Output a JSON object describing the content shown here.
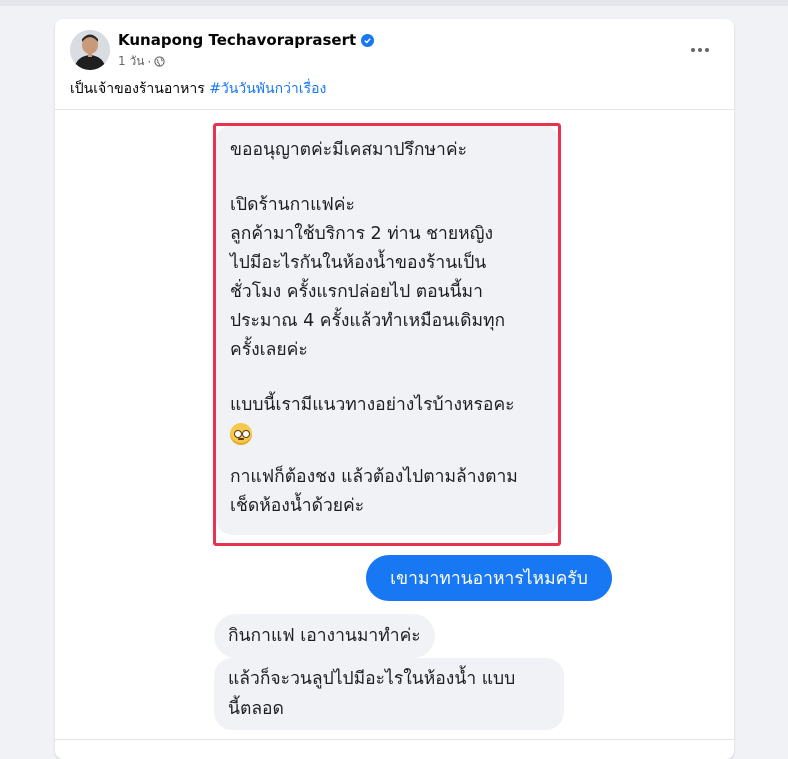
{
  "post": {
    "author": "Kunapong Techavoraprasert",
    "time": "1 วัน",
    "separator": "·",
    "caption_text": "เป็นเจ้าของร้านอาหาร",
    "hashtag": "#วันวันพันกว่าเรื่อง"
  },
  "icons": {
    "verified": "verified-badge-icon",
    "privacy": "globe-icon",
    "more": "more-options-icon",
    "emoji": "pleading-face-emoji"
  },
  "chat": {
    "highlighted_message": {
      "p1": "ขออนุญาตค่ะมีเคสมาปรึกษาค่ะ",
      "p2": "เปิดร้านกาแฟค่ะ\nลูกค้ามาใช้บริการ 2 ท่าน ชายหญิง\nไปมีอะไรกันในห้องน้ำของร้านเป็น\nชั่วโมง ครั้งแรกปล่อยไป ตอนนี้มา\nประมาณ 4 ครั้งแล้วทำเหมือนเดิมทุก\nครั้งเลยค่ะ",
      "p3": "แบบนี้เรามีแนวทางอย่างไรบ้างหรอคะ",
      "p4": "กาแฟก็ต้องชง แล้วต้องไปตามล้างตาม\nเช็ดห้องน้ำด้วยค่ะ"
    },
    "sent_reply": "เขามาทานอาหารไหมครับ",
    "received_1": "กินกาแฟ เอางานมาทำค่ะ",
    "received_2_line1": "แล้วก็จะวนลูปไปมีอะไรในห้องน้ำ  แบบ",
    "received_2_line2": "นี้ตลอด"
  },
  "colors": {
    "accent_blue": "#1877f2",
    "highlight_red": "#e8334f",
    "bubble_gray": "#f0f2f5"
  }
}
